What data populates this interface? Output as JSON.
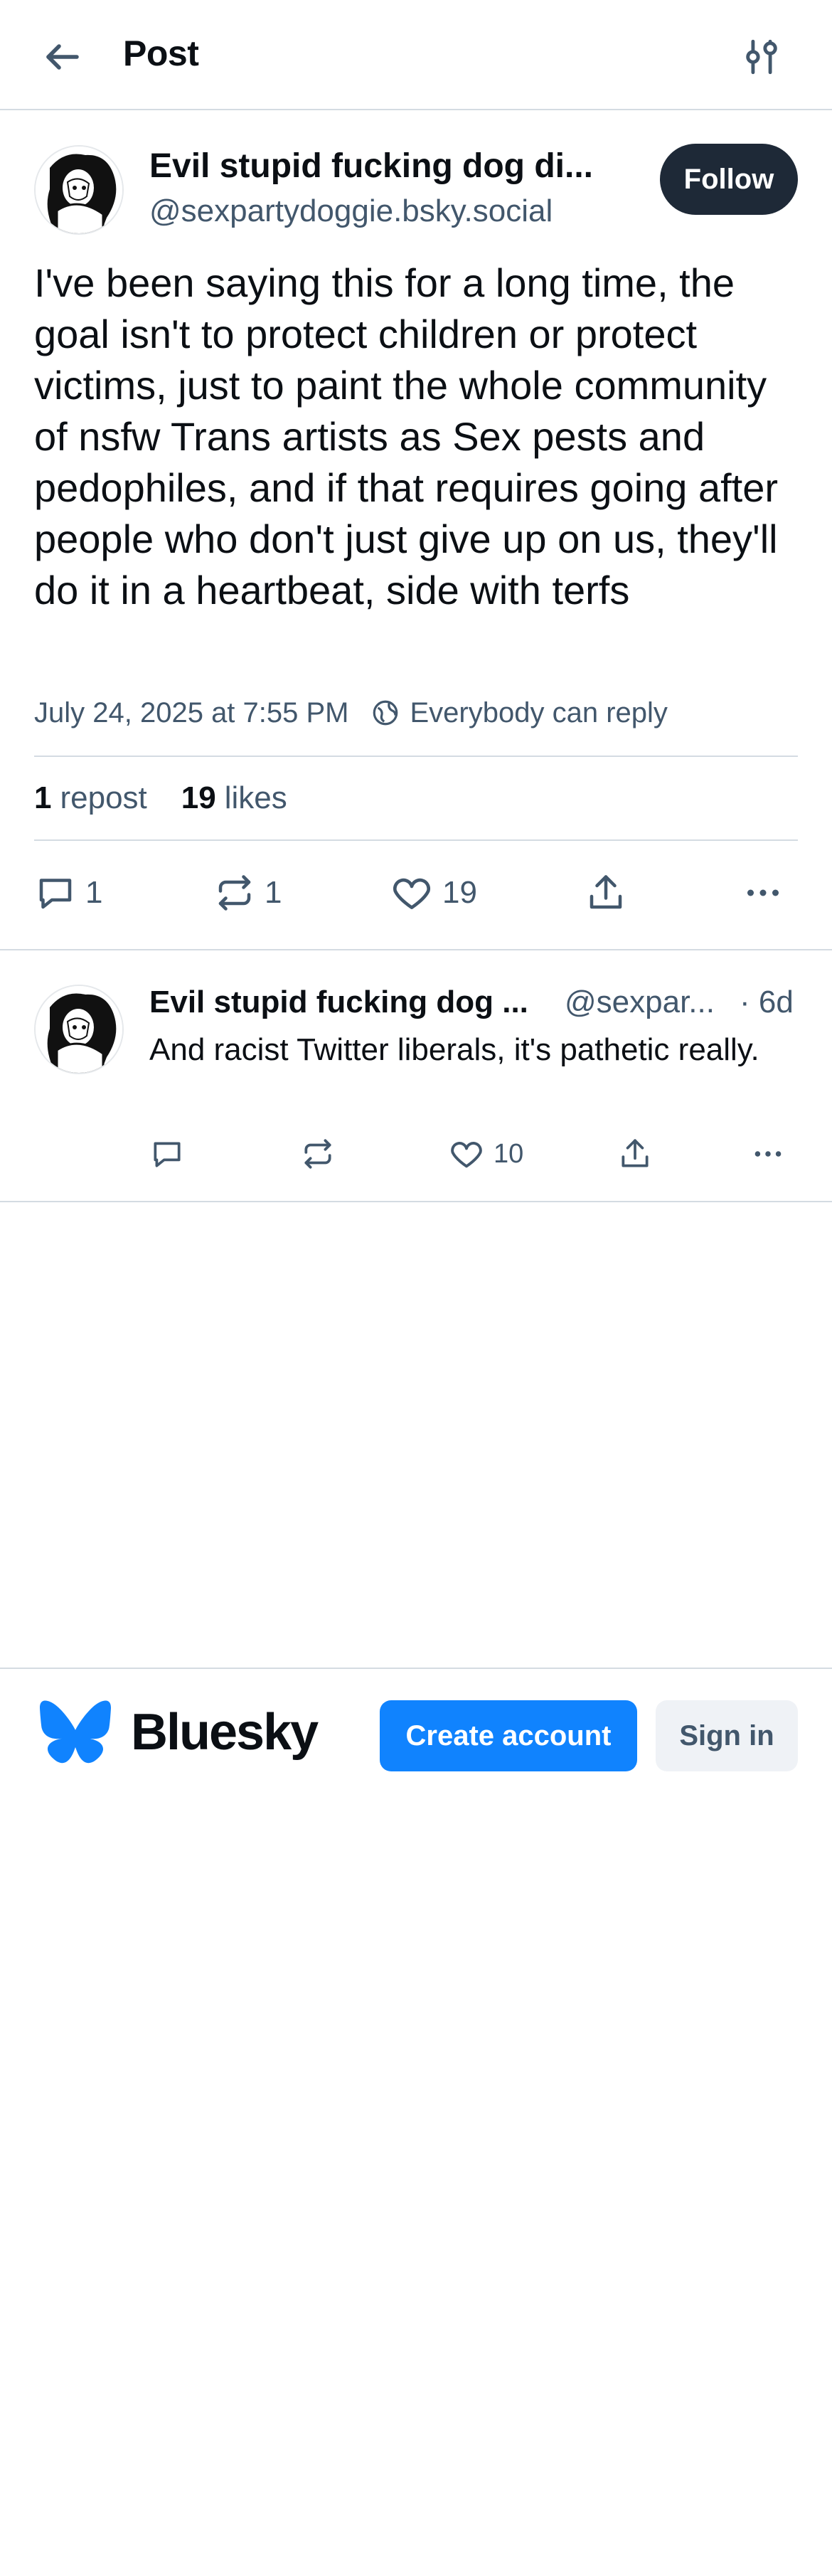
{
  "header": {
    "title": "Post",
    "back_icon": "arrow-left-icon",
    "settings_icon": "sliders-icon"
  },
  "post": {
    "author_name": "Evil stupid fucking dog di...",
    "author_handle": "@sexpartydoggie.bsky.social",
    "follow_label": "Follow",
    "text": "I've been saying this for a long time, the goal isn't to protect children or protect victims, just to paint the whole community of nsfw Trans artists as Sex pests and pedophiles, and if that requires going after people who don't just give up on us, they'll do it in a heartbeat, side with terfs",
    "timestamp": "July 24, 2025 at 7:55 PM",
    "reply_setting": "Everybody can reply",
    "reposts_count": "1",
    "reposts_label": "repost",
    "likes_count": "19",
    "likes_label": "likes",
    "actions": {
      "reply_count": "1",
      "repost_count": "1",
      "like_count": "19"
    }
  },
  "reply": {
    "author_name": "Evil stupid fucking dog ...",
    "author_handle": "@sexpar...",
    "time": "· 6d",
    "text": "And racist Twitter liberals, it's pathetic really.",
    "like_count": "10"
  },
  "footer": {
    "brand": "Bluesky",
    "create_account_label": "Create account",
    "sign_in_label": "Sign in"
  },
  "colors": {
    "primary": "#1083fe",
    "text": "#0b0f14",
    "muted": "#42576c",
    "divider": "#d4dbe2",
    "follow_bg": "#1e2937"
  }
}
